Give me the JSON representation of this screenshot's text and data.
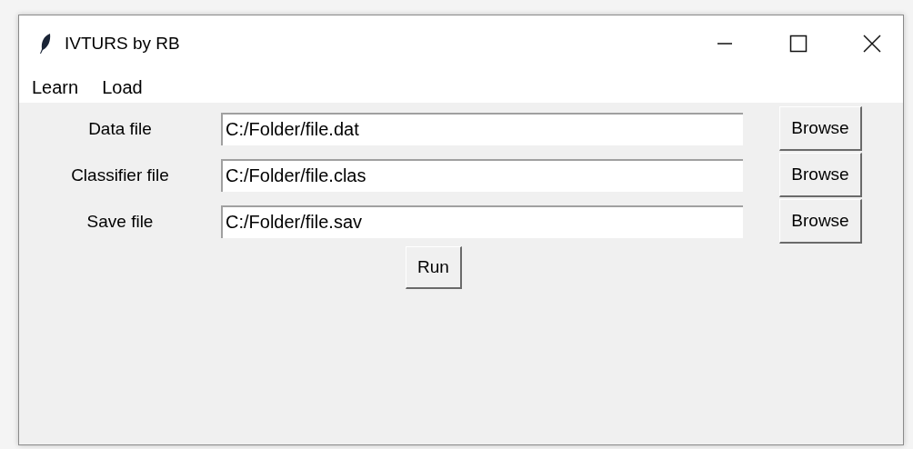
{
  "window": {
    "title": "IVTURS by RB"
  },
  "menu": [
    "Learn",
    "Load"
  ],
  "fields": [
    {
      "label": "Data file",
      "value": "C:/Folder/file.dat",
      "button": "Browse"
    },
    {
      "label": "Classifier file",
      "value": "C:/Folder/file.clas",
      "button": "Browse"
    },
    {
      "label": "Save file",
      "value": "C:/Folder/file.sav",
      "button": "Browse"
    }
  ],
  "run_button": "Run"
}
